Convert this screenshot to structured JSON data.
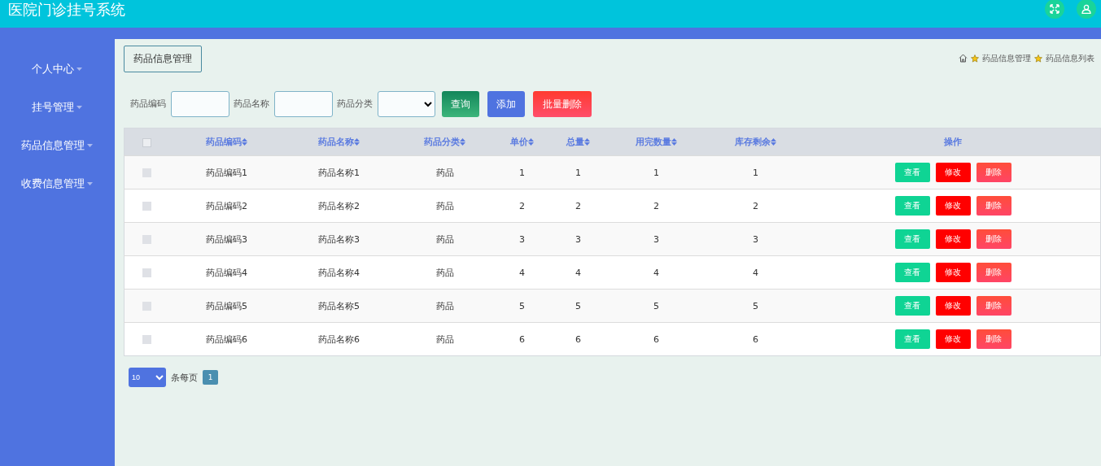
{
  "header": {
    "title": "医院门诊挂号系统"
  },
  "sidebar": {
    "items": [
      {
        "label": "个人中心"
      },
      {
        "label": "挂号管理"
      },
      {
        "label": "药品信息管理"
      },
      {
        "label": "收费信息管理"
      }
    ]
  },
  "page_tag": "药品信息管理",
  "breadcrumb": [
    "药品信息管理",
    "药品信息列表"
  ],
  "search": {
    "fields": [
      {
        "label": "药品编码",
        "kind": "input"
      },
      {
        "label": "药品名称",
        "kind": "input"
      },
      {
        "label": "药品分类",
        "kind": "select"
      }
    ],
    "buttons": [
      {
        "label": "查询",
        "kind": "query"
      },
      {
        "label": "添加",
        "kind": "add"
      },
      {
        "label": "批量删除",
        "kind": "delete"
      }
    ]
  },
  "table": {
    "select_all": {
      "checked": false
    },
    "columns": [
      "药品编码",
      "药品名称",
      "药品分类",
      "单价",
      "总量",
      "用完数量",
      "库存剩余",
      "操作"
    ],
    "rows": [
      {
        "checked": false,
        "cells": [
          "药品编码1",
          "药品名称1",
          "药品",
          "1",
          "1",
          "1",
          "1"
        ],
        "actions": [
          {
            "label": "查看",
            "kind": "view"
          },
          {
            "label": "修改",
            "kind": "edit"
          },
          {
            "label": "删除",
            "kind": "delete"
          }
        ]
      },
      {
        "checked": false,
        "cells": [
          "药品编码2",
          "药品名称2",
          "药品",
          "2",
          "2",
          "2",
          "2"
        ],
        "actions": [
          {
            "label": "查看",
            "kind": "view"
          },
          {
            "label": "修改",
            "kind": "edit"
          },
          {
            "label": "删除",
            "kind": "delete"
          }
        ]
      },
      {
        "checked": false,
        "cells": [
          "药品编码3",
          "药品名称3",
          "药品",
          "3",
          "3",
          "3",
          "3"
        ],
        "actions": [
          {
            "label": "查看",
            "kind": "view"
          },
          {
            "label": "修改",
            "kind": "edit"
          },
          {
            "label": "删除",
            "kind": "delete"
          }
        ]
      },
      {
        "checked": false,
        "cells": [
          "药品编码4",
          "药品名称4",
          "药品",
          "4",
          "4",
          "4",
          "4"
        ],
        "actions": [
          {
            "label": "查看",
            "kind": "view"
          },
          {
            "label": "修改",
            "kind": "edit"
          },
          {
            "label": "删除",
            "kind": "delete"
          }
        ]
      },
      {
        "checked": false,
        "cells": [
          "药品编码5",
          "药品名称5",
          "药品",
          "5",
          "5",
          "5",
          "5"
        ],
        "actions": [
          {
            "label": "查看",
            "kind": "view"
          },
          {
            "label": "修改",
            "kind": "edit"
          },
          {
            "label": "删除",
            "kind": "delete"
          }
        ]
      },
      {
        "checked": false,
        "cells": [
          "药品编码6",
          "药品名称6",
          "药品",
          "6",
          "6",
          "6",
          "6"
        ],
        "actions": [
          {
            "label": "查看",
            "kind": "view"
          },
          {
            "label": "修改",
            "kind": "edit"
          },
          {
            "label": "删除",
            "kind": "delete"
          }
        ]
      }
    ]
  },
  "pagination": {
    "page_size": "10",
    "per_page_label": "条每页",
    "pages": [
      {
        "label": "1",
        "selected": true
      }
    ]
  }
}
